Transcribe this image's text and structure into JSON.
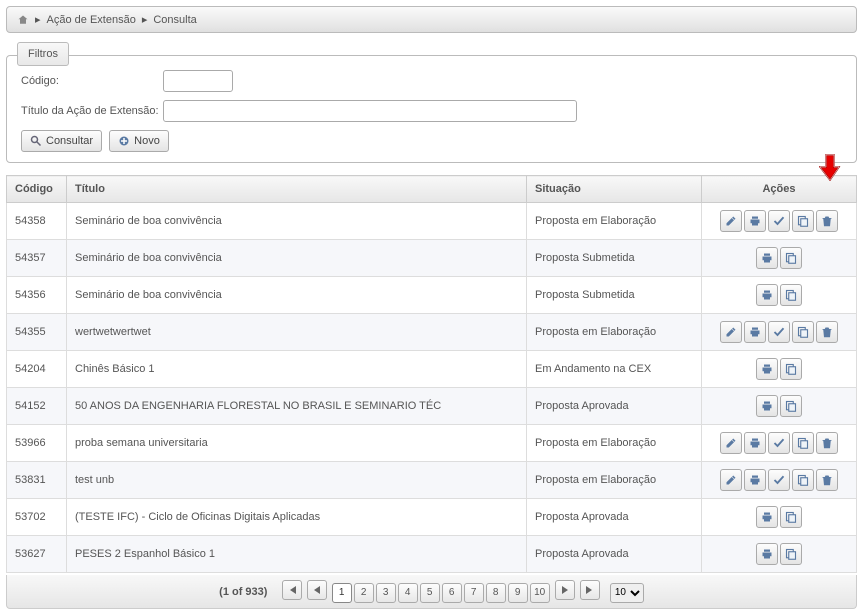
{
  "breadcrumb": {
    "sep": "▸",
    "lvl1": "Ação de Extensão",
    "lvl2": "Consulta"
  },
  "filters": {
    "legend": "Filtros",
    "codigo_label": "Código:",
    "titulo_label": "Título da Ação de Extensão:",
    "consultar_label": "Consultar",
    "novo_label": "Novo"
  },
  "grid": {
    "headers": {
      "codigo": "Código",
      "titulo": "Título",
      "situacao": "Situação",
      "acoes": "Ações"
    },
    "rows": [
      {
        "codigo": "54358",
        "titulo": "Seminário de boa convivência",
        "situacao": "Proposta em Elaboração",
        "actions": "full"
      },
      {
        "codigo": "54357",
        "titulo": "Seminário de boa convivência",
        "situacao": "Proposta Submetida",
        "actions": "pair"
      },
      {
        "codigo": "54356",
        "titulo": "Seminário de boa convivência",
        "situacao": "Proposta Submetida",
        "actions": "pair"
      },
      {
        "codigo": "54355",
        "titulo": "wertwetwertwet",
        "situacao": "Proposta em Elaboração",
        "actions": "full"
      },
      {
        "codigo": "54204",
        "titulo": "Chinês Básico 1",
        "situacao": "Em Andamento na CEX",
        "actions": "pair"
      },
      {
        "codigo": "54152",
        "titulo": "50 ANOS DA ENGENHARIA FLORESTAL NO BRASIL E SEMINARIO TÉC",
        "situacao": "Proposta Aprovada",
        "actions": "pair"
      },
      {
        "codigo": "53966",
        "titulo": "proba semana universitaria",
        "situacao": "Proposta em Elaboração",
        "actions": "full"
      },
      {
        "codigo": "53831",
        "titulo": "test unb",
        "situacao": "Proposta em Elaboração",
        "actions": "full"
      },
      {
        "codigo": "53702",
        "titulo": "(TESTE IFC) - Ciclo de Oficinas Digitais Aplicadas",
        "situacao": "Proposta Aprovada",
        "actions": "pair"
      },
      {
        "codigo": "53627",
        "titulo": "PESES 2 Espanhol Básico 1",
        "situacao": "Proposta Aprovada",
        "actions": "pair"
      }
    ]
  },
  "paginator": {
    "count": "(1 of 933)",
    "pages": [
      "1",
      "2",
      "3",
      "4",
      "5",
      "6",
      "7",
      "8",
      "9",
      "10"
    ],
    "current": "1",
    "page_size": "10"
  },
  "icons": {
    "edit": "edit-icon",
    "print": "print-icon",
    "check": "check-icon",
    "copy": "copy-icon",
    "trash": "trash-icon",
    "search": "search-icon",
    "plus": "plus-icon",
    "home": "home-icon"
  }
}
